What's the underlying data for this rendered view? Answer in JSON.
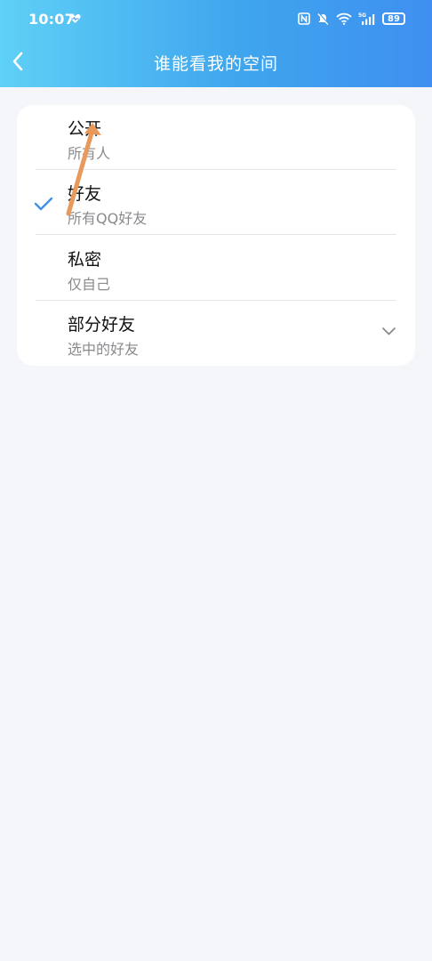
{
  "status_bar": {
    "time": "10:07",
    "battery": "89",
    "icons": [
      "heart-icon",
      "nfc-icon",
      "mute-icon",
      "wifi-icon",
      "5g-signal-icon",
      "battery-icon"
    ]
  },
  "header": {
    "title": "谁能看我的空间",
    "back_icon": "chevron-left-icon"
  },
  "options": [
    {
      "label": "公开",
      "sub": "所有人",
      "selected": false
    },
    {
      "label": "好友",
      "sub": "所有QQ好友",
      "selected": true
    },
    {
      "label": "私密",
      "sub": "仅自己",
      "selected": false
    },
    {
      "label": "部分好友",
      "sub": "选中的好友",
      "selected": false,
      "expand_icon": "chevron-down-icon"
    }
  ],
  "colors": {
    "header_start": "#5fd0f6",
    "header_end": "#3f8ff0",
    "check": "#3f8fe6",
    "annotation_arrow": "#e89a5c",
    "background": "#f4f6fa"
  }
}
